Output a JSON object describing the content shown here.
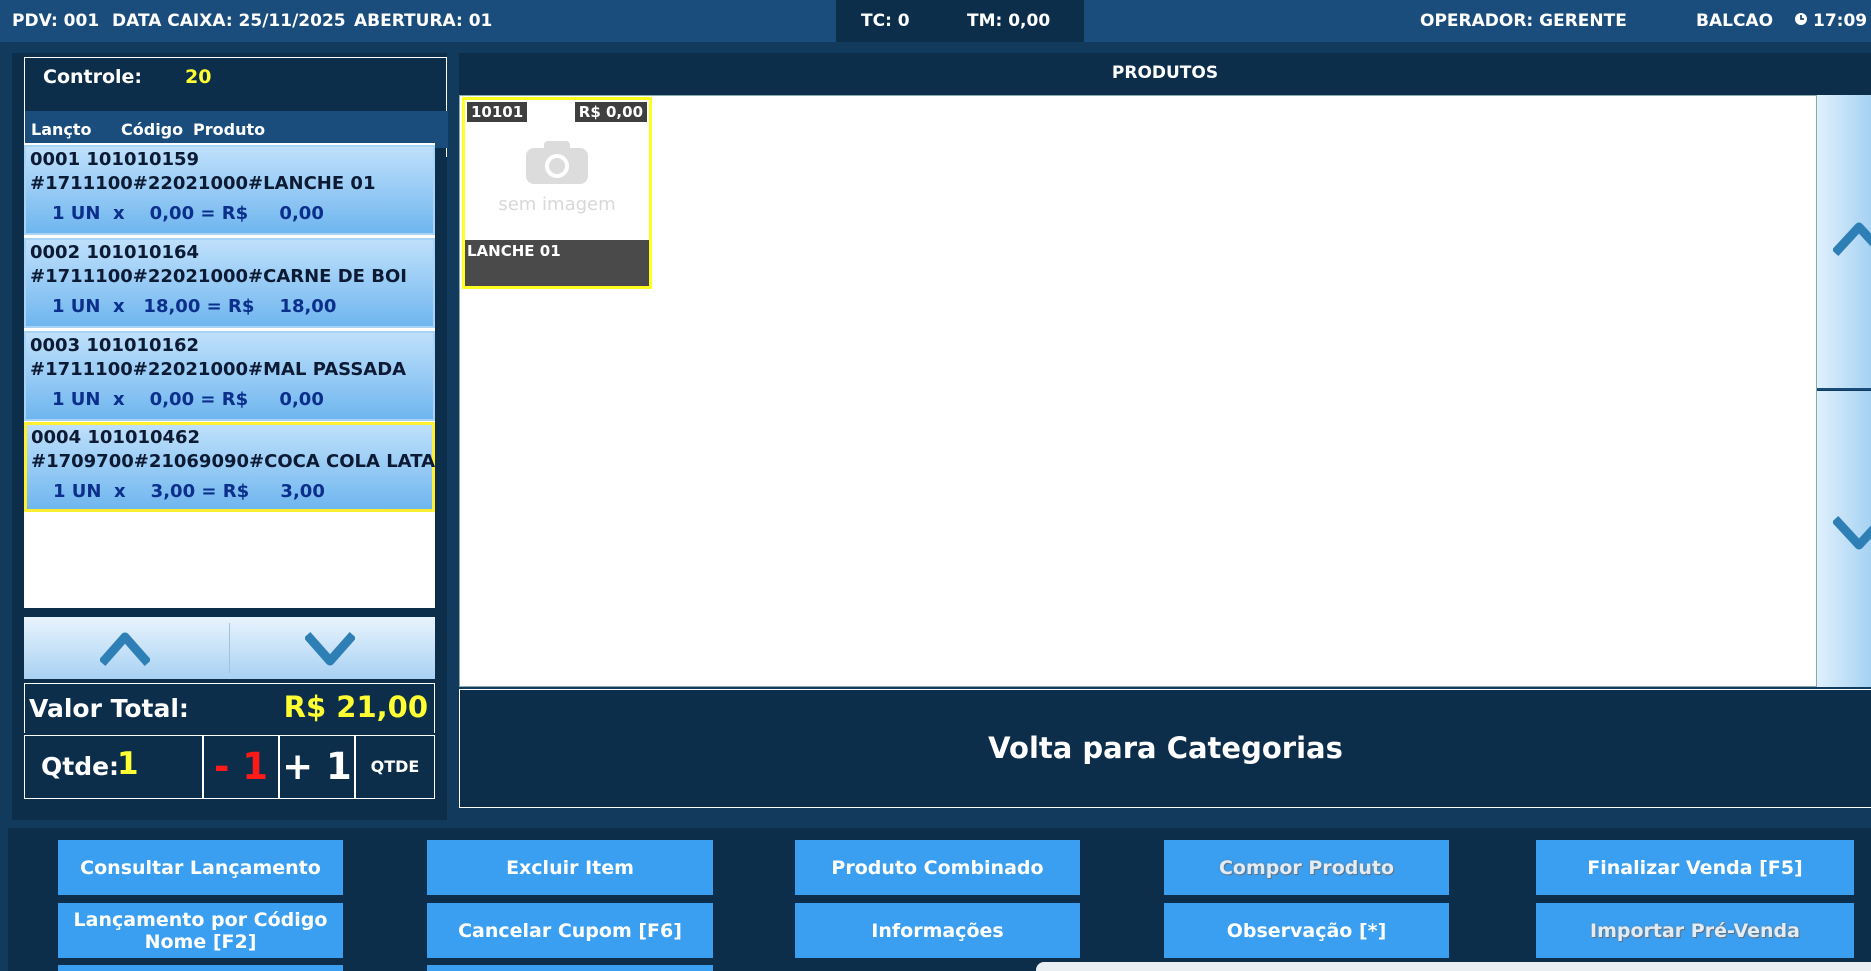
{
  "topbar": {
    "pdv": "PDV: 001",
    "data_caixa": "DATA CAIXA: 25/11/2025",
    "abertura": "ABERTURA: 01",
    "tc": "TC:  0",
    "tm": "TM: 0,00",
    "operador": "OPERADOR:  GERENTE",
    "modo": "BALCAO",
    "hora": "17:09",
    "clock_icon": "clock-icon"
  },
  "controle": {
    "label": "Controle:",
    "value": "20"
  },
  "columns": {
    "lancto": "Lançto",
    "codigo": "Código",
    "produto": "Produto"
  },
  "items": [
    {
      "l1": "0001 101010159",
      "l2": "#1711100#22021000#LANCHE 01",
      "l3": "1 UN  x    0,00 = R$     0,00"
    },
    {
      "l1": "0002 101010164",
      "l2": "#1711100#22021000#CARNE DE BOI",
      "l3": "1 UN  x   18,00 = R$    18,00"
    },
    {
      "l1": "0003 101010162",
      "l2": "#1711100#22021000#MAL PASSADA",
      "l3": "1 UN  x    0,00 = R$     0,00"
    },
    {
      "l1": "0004 101010462",
      "l2": "#1709700#21069090#COCA COLA LATA",
      "l3": "1 UN  x    3,00 = R$     3,00"
    }
  ],
  "totals": {
    "label": "Valor Total:",
    "value": "R$ 21,00"
  },
  "qty": {
    "label": "Qtde:",
    "value": "1",
    "minus": "- 1",
    "plus": "+ 1",
    "qtde_btn": "QTDE"
  },
  "produtos": {
    "title": "PRODUTOS",
    "tiles": [
      {
        "code": "10101",
        "price": "R$ 0,00",
        "placeholder": "sem imagem",
        "name": "LANCHE 01"
      }
    ]
  },
  "volta": "Volta para Categorias",
  "buttons": {
    "consultar": "Consultar Lançamento",
    "lanc_codigo": "Lançamento por Código Nome [F2]",
    "excluir": "Excluir Item",
    "cancelar": "Cancelar Cupom [F6]",
    "combinado": "Produto Combinado",
    "informacoes": "Informações",
    "compor": "Compor Produto",
    "observacao": "Observação [*]",
    "finalizar": "Finalizar Venda [F5]",
    "importar": "Importar Pré-Venda"
  },
  "colors": {
    "dark_navy": "#0d2e4b",
    "bar_blue": "#1a4d7c",
    "button_blue": "#3a9ff0",
    "highlight_yellow": "#ffff33",
    "minus_red": "#ff1a1a"
  }
}
